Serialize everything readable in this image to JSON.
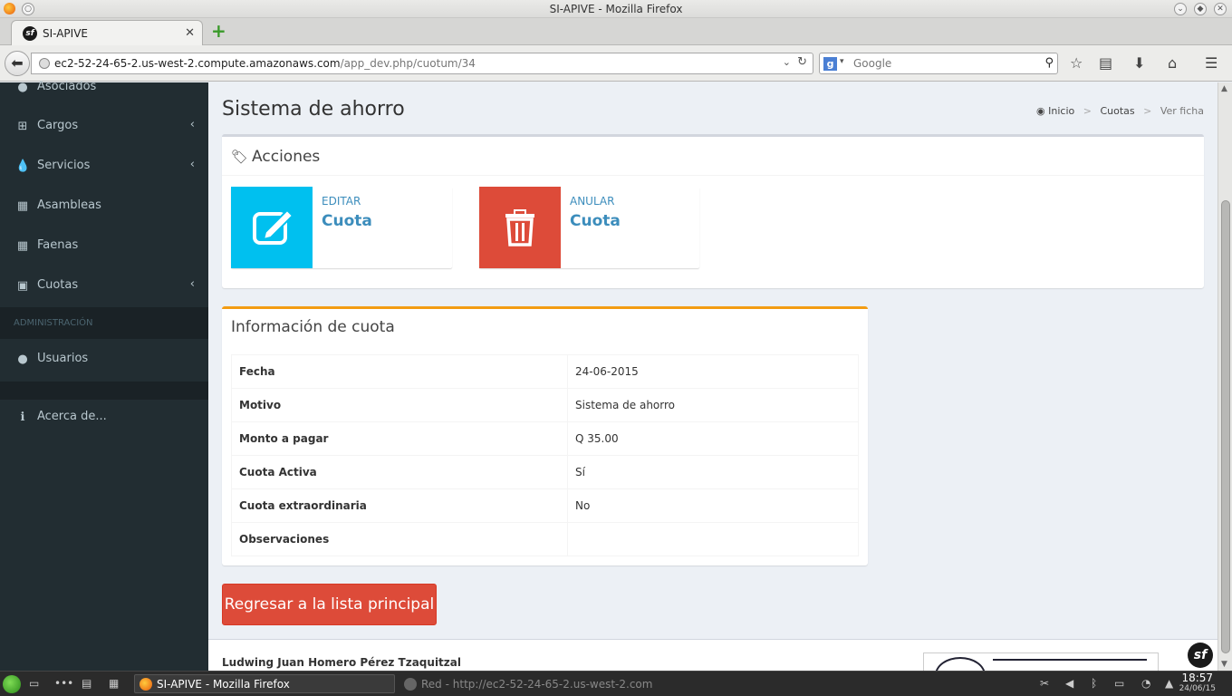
{
  "browser": {
    "window_title": "SI-APIVE - Mozilla Firefox",
    "tab_label": "SI-APIVE",
    "url_host": "ec2-52-24-65-2.us-west-2.compute.amazonaws.com",
    "url_path": "/app_dev.php/cuotum/34",
    "search_placeholder": "Google"
  },
  "sidebar": {
    "items": [
      {
        "label": "Asociados",
        "icon": "users-icon"
      },
      {
        "label": "Cargos",
        "icon": "sitemap-icon"
      },
      {
        "label": "Servicios",
        "icon": "tint-icon"
      },
      {
        "label": "Asambleas",
        "icon": "calendar-icon"
      },
      {
        "label": "Faenas",
        "icon": "calendar-icon"
      },
      {
        "label": "Cuotas",
        "icon": "money-icon"
      }
    ],
    "admin_header": "ADMINISTRACIÓN",
    "usuarios": "Usuarios",
    "acerca": "Acerca de..."
  },
  "page": {
    "title": "Sistema de ahorro",
    "breadcrumb": [
      "Inicio",
      "Cuotas",
      "Ver ficha"
    ]
  },
  "acciones": {
    "title": "Acciones",
    "editar": {
      "text": "EDITAR",
      "number": "Cuota",
      "color": "#00c0ef"
    },
    "anular": {
      "text": "ANULAR",
      "number": "Cuota",
      "color": "#dd4b39"
    }
  },
  "info": {
    "title": "Información de cuota",
    "rows": [
      {
        "key": "Fecha",
        "value": "24-06-2015"
      },
      {
        "key": "Motivo",
        "value": "Sistema de ahorro"
      },
      {
        "key": "Monto a pagar",
        "value": "Q 35.00"
      },
      {
        "key": "Cuota Activa",
        "value": "Sí"
      },
      {
        "key": "Cuota extraordinaria",
        "value": "No"
      },
      {
        "key": "Observaciones",
        "value": ""
      }
    ]
  },
  "back_button": "Regresar a la lista principal",
  "footer": {
    "author": "Ludwing Juan Homero Pérez Tzaquitzal"
  },
  "taskbar": {
    "active_window": "SI-APIVE - Mozilla Firefox",
    "inactive_window": "Red - http://ec2-52-24-65-2.us-west-2.com",
    "time": "18:57",
    "date": "24/06/15"
  }
}
